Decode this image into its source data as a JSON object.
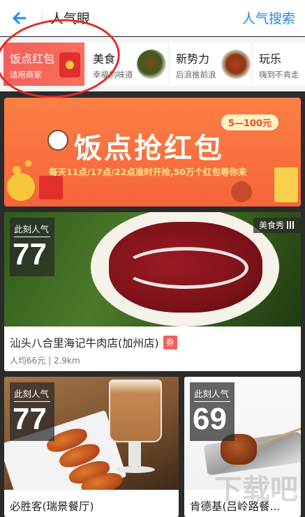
{
  "header": {
    "title": "人气眼",
    "action": "人气搜索",
    "accent": "#1f8ceb"
  },
  "categories": [
    {
      "name": "饭点红包",
      "sub": "适用商家",
      "active": true
    },
    {
      "name": "美食",
      "sub": "幸福的味道",
      "active": false
    },
    {
      "name": "新势力",
      "sub": "后浪推前浪",
      "active": false
    },
    {
      "name": "玩乐",
      "sub": "嗨到不肯走",
      "active": false
    }
  ],
  "banner": {
    "title": "饭点抢红包",
    "badge": "5—100元",
    "subtitle": "每天11点/17点/22点准时开抢,50万个红包等你来"
  },
  "featured": {
    "hot_label": "此刻人气",
    "hot_value": "77",
    "tag": "美食秀",
    "name": "汕头八合里海记牛肉店(加州店)",
    "coupon": "券",
    "meta": "人均66元 | 2.9km"
  },
  "cards": [
    {
      "hot_label": "此刻人气",
      "hot_value": "77",
      "name": "必胜客(瑞景餐厅)"
    },
    {
      "hot_label": "此刻人气",
      "hot_value": "69",
      "name": "肯德基(吕岭路餐..."
    }
  ],
  "watermark": "下载吧",
  "icons": [
    "back-arrow-icon",
    "envelope-icon",
    "bar-chart-icon"
  ],
  "colors": {
    "red_accent": "#f4605c",
    "annotation_red": "#e8292a",
    "banner_orange": "#f6653a"
  }
}
